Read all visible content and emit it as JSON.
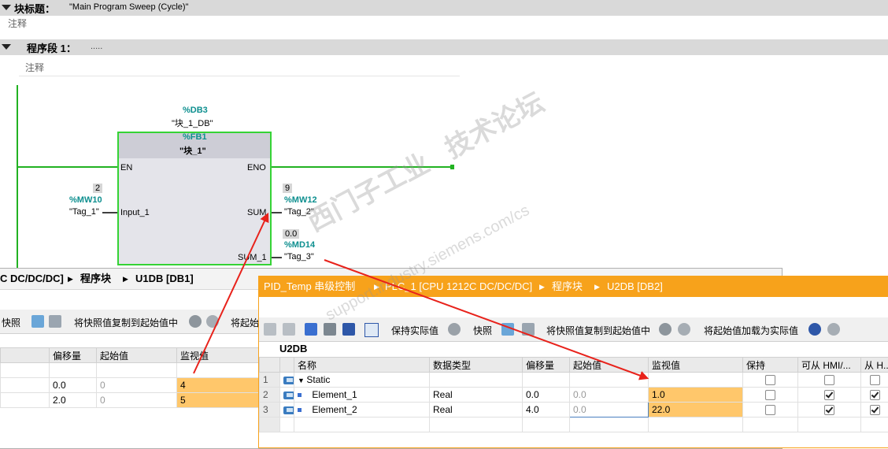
{
  "block_title": {
    "label": "块标题：",
    "value": "\"Main Program Sweep (Cycle)\"",
    "comment": "注释"
  },
  "network": {
    "label": "程序段 1：",
    "value": ".....",
    "comment": "注释"
  },
  "fb_block": {
    "db_number": "%DB3",
    "db_name": "\"块_1_DB\"",
    "fb_number": "%FB1",
    "fb_name": "\"块_1\"",
    "pin_en": "EN",
    "pin_eno": "ENO",
    "pin_input": "Input_1",
    "pin_sum": "SUM",
    "pin_sum1": "SUM_1",
    "in_value": "2",
    "in_address": "%MW10",
    "in_tag": "\"Tag_1\"",
    "sum_value": "9",
    "sum_address": "%MW12",
    "sum_tag": "\"Tag_2\"",
    "sum1_value": "0.0",
    "sum1_address": "%MD14",
    "sum1_tag": "\"Tag_3\""
  },
  "watermark": {
    "line1": "西门子工业",
    "line2": "技术论坛",
    "line3": "support.industry.siemens.com/cs"
  },
  "u1db_window": {
    "breadcrumb": [
      "C DC/DC/DC]",
      "程序块",
      "U1DB [DB1]"
    ],
    "toolbar": {
      "snapshot": "快照",
      "copy_snapshot": "将快照值复制到起始值中",
      "load_start": "将起始"
    },
    "columns": [
      "偏移量",
      "起始值",
      "监视值"
    ],
    "rows": [
      {
        "offset": "0.0",
        "start": "0",
        "monitor": "4"
      },
      {
        "offset": "2.0",
        "start": "0",
        "monitor": "5"
      }
    ]
  },
  "u2db_window": {
    "title_parts": [
      "PID_Temp 串级控制",
      "PLC_1 [CPU 1212C DC/DC/DC]",
      "程序块",
      "U2DB [DB2]"
    ],
    "toolbar": {
      "keep_actual": "保持实际值",
      "snapshot": "快照",
      "copy_snapshot": "将快照值复制到起始值中",
      "load_start": "将起始值加载为实际值"
    },
    "db_name": "U2DB",
    "columns": [
      "名称",
      "数据类型",
      "偏移量",
      "起始值",
      "监视值",
      "保持",
      "可从 HMI/...",
      "从 H..."
    ],
    "rows": [
      {
        "num": "1",
        "name": "Static",
        "type": "",
        "offset": "",
        "start": "",
        "monitor": "",
        "retain": false,
        "hmi": false,
        "from_h": false
      },
      {
        "num": "2",
        "name": "Element_1",
        "type": "Real",
        "offset": "0.0",
        "start": "0.0",
        "monitor": "1.0",
        "retain": false,
        "hmi": true,
        "from_h": true
      },
      {
        "num": "3",
        "name": "Element_2",
        "type": "Real",
        "offset": "4.0",
        "start": "0.0",
        "monitor": "22.0",
        "retain": false,
        "hmi": true,
        "from_h": true
      }
    ]
  },
  "colors": {
    "accent_orange": "#f7a21b",
    "monitor_cell": "#ffc76b",
    "power_rail": "#22b222",
    "address_teal": "#0d8f8f",
    "arrow_red": "#e8221b"
  }
}
